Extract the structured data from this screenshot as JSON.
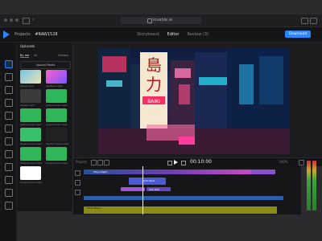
{
  "browser": {
    "url": "lovable.ai"
  },
  "app": {
    "project_label": "Projects",
    "project_name": "#RAW1528",
    "tabs": [
      "Storyboard",
      "Editor",
      "Review (3)"
    ],
    "active_tab": "Editor",
    "download_label": "Download",
    "accent": "#2e86ff"
  },
  "media_panel": {
    "title": "Uploads",
    "filters": [
      "By me",
      "All",
      "Folders"
    ],
    "upload_label": "Upload Media",
    "items": [
      {
        "label": "beach.mp4"
      },
      {
        "label": "gradient.mp4"
      },
      {
        "label": "screen.mp4"
      },
      {
        "label": "greenscreen.mp4"
      },
      {
        "label": "greenscreen.mp4"
      },
      {
        "label": "greenscreen.mp4"
      },
      {
        "label": "Greenscreen.mp4"
      },
      {
        "label": "Tip for mobile.mp4"
      },
      {
        "label": "Greenscreen.mp4"
      },
      {
        "label": "Greenscreen.mp4"
      },
      {
        "label": "Greenscreen.mp4"
      }
    ]
  },
  "player": {
    "timecode": "00:10:00",
    "project_label": "Project",
    "zoom": "100%"
  },
  "timeline": {
    "clips": [
      "Tokyo Night",
      "Add Style",
      "Add Text",
      "Track Music"
    ],
    "progress": 0.29
  },
  "video": {
    "signs": [
      "島",
      "力",
      "BAIKI"
    ]
  }
}
